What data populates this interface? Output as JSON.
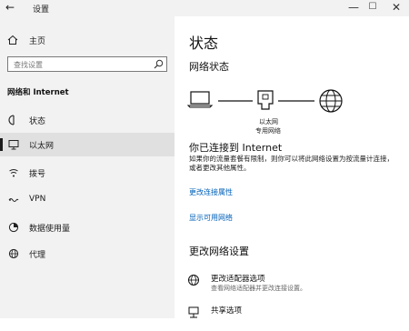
{
  "window": {
    "title": "设置",
    "back_glyph": "←",
    "minimize_glyph": "—",
    "maximize_glyph": "☐",
    "close_glyph": "✕"
  },
  "sidebar": {
    "home_label": "主页",
    "search_placeholder": "查找设置",
    "section_title": "网络和 Internet",
    "items": [
      {
        "label": "状态",
        "icon": "status-icon",
        "active": false
      },
      {
        "label": "以太网",
        "icon": "ethernet-icon",
        "active": true
      },
      {
        "label": "拨号",
        "icon": "dialup-icon",
        "active": false
      },
      {
        "label": "VPN",
        "icon": "vpn-icon",
        "active": false
      },
      {
        "label": "数据使用量",
        "icon": "data-usage-icon",
        "active": false
      },
      {
        "label": "代理",
        "icon": "proxy-icon",
        "active": false
      }
    ]
  },
  "main": {
    "title": "状态",
    "network_status_heading": "网络状态",
    "diagram": {
      "node_label_line1": "以太网",
      "node_label_line2": "专用网络"
    },
    "connected_title": "你已连接到 Internet",
    "connected_desc": "如果你的流量套餐有限制，则你可以将此网络设置为按流量计连接，或者更改其他属性。",
    "links": {
      "change_properties": "更改连接属性",
      "show_networks": "显示可用网络"
    },
    "change_settings_heading": "更改网络设置",
    "options": [
      {
        "title": "更改适配器选项",
        "desc": "查看网络适配器并更改连接设置。",
        "icon": "adapter-icon"
      },
      {
        "title": "共享选项",
        "desc": "",
        "icon": "sharing-icon"
      }
    ]
  },
  "colors": {
    "accent_link": "#0060b8",
    "sidebar_bg": "#f2f2f2",
    "active_item_bg": "#e0e0e0"
  }
}
